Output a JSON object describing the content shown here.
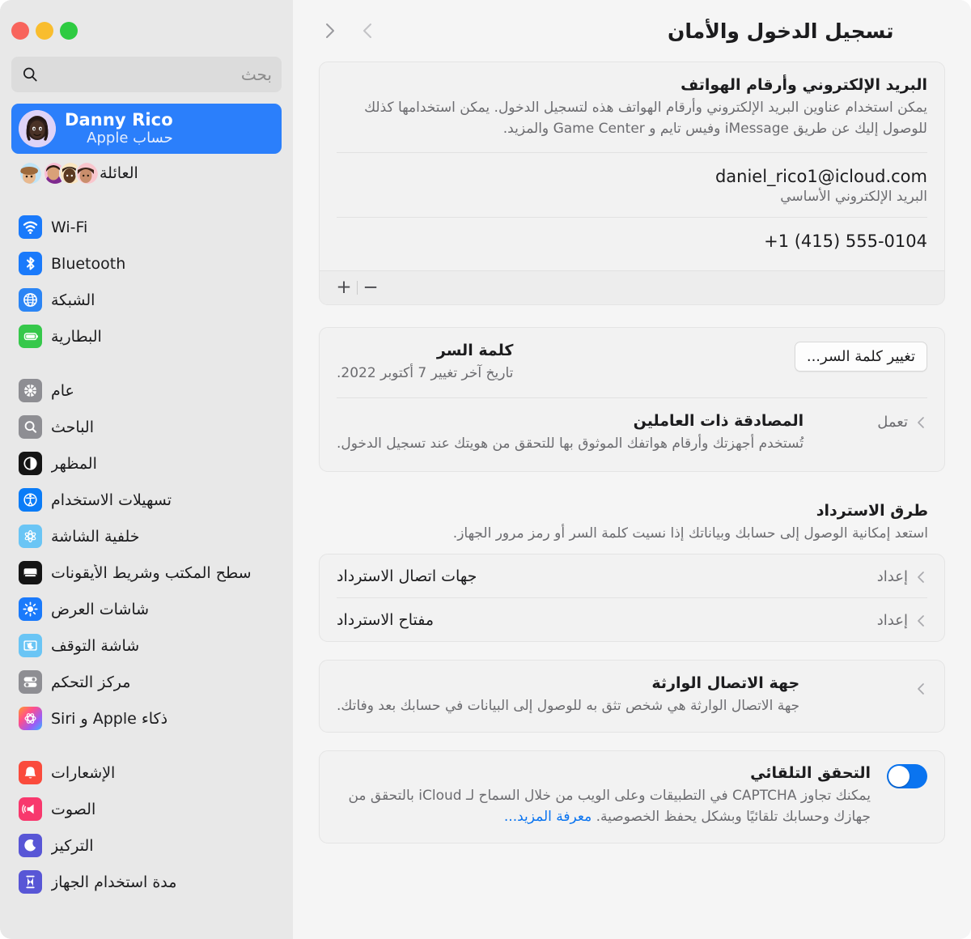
{
  "window": {
    "traffic_lights": [
      "close",
      "minimize",
      "zoom"
    ],
    "accent_blue": "#2b7ffb",
    "link_blue": "#0a74f0"
  },
  "sidebar": {
    "search": {
      "placeholder": "بحث",
      "value": "",
      "icon": "search-icon"
    },
    "account": {
      "name": "Danny Rico",
      "subtitle": "حساب Apple",
      "selected": true,
      "avatar": "memoji-avatar"
    },
    "family": {
      "label": "العائلة",
      "avatar_count": 4
    },
    "groups": [
      {
        "items": [
          {
            "label": "Wi-Fi",
            "icon": "wifi-icon",
            "color": "#1a7afb"
          },
          {
            "label": "Bluetooth",
            "icon": "bluetooth-icon",
            "color": "#1a7afb"
          },
          {
            "label": "الشبكة",
            "icon": "globe-icon",
            "color": "#2b85f5"
          },
          {
            "label": "البطارية",
            "icon": "battery-icon",
            "color": "#36c84b"
          }
        ]
      },
      {
        "items": [
          {
            "label": "عام",
            "icon": "gear-icon",
            "color": "#8e8e93"
          },
          {
            "label": "الباحث",
            "icon": "magnifier-icon",
            "color": "#8e8e93"
          },
          {
            "label": "المظهر",
            "icon": "appearance-icon",
            "color": "#1c1c1e"
          },
          {
            "label": "تسهيلات الاستخدام",
            "icon": "accessibility-icon",
            "color": "#0a7cf7"
          },
          {
            "label": "خلفية الشاشة",
            "icon": "wallpaper-icon",
            "color": "#6ac5f5"
          },
          {
            "label": "سطح المكتب وشريط الأيقونات",
            "icon": "desktop-dock-icon",
            "color": "#1c1c1e"
          },
          {
            "label": "شاشات العرض",
            "icon": "displays-icon",
            "color": "#1a7afb"
          },
          {
            "label": "شاشة التوقف",
            "icon": "screensaver-icon",
            "color": "#6ac5f5"
          },
          {
            "label": "مركز التحكم",
            "icon": "control-center-icon",
            "color": "#8e8e93"
          },
          {
            "label": "ذكاء Apple و Siri",
            "icon": "siri-icon",
            "color": "#ff4f8b"
          }
        ]
      },
      {
        "items": [
          {
            "label": "الإشعارات",
            "icon": "bell-icon",
            "color": "#fa4b3c"
          },
          {
            "label": "الصوت",
            "icon": "sound-icon",
            "color": "#f8386d"
          },
          {
            "label": "التركيز",
            "icon": "focus-moon-icon",
            "color": "#5856d6"
          },
          {
            "label": "مدة استخدام الجهاز",
            "icon": "screentime-icon",
            "color": "#5856d6"
          }
        ]
      }
    ]
  },
  "main": {
    "title": "تسجيل الدخول والأمان",
    "nav": {
      "back": "chevron-right-icon",
      "forward": "chevron-left-icon"
    },
    "email_card": {
      "title": "البريد الإلكتروني وأرقام الهواتف",
      "description": "يمكن استخدام عناوين البريد الإلكتروني وأرقام الهواتف هذه لتسجيل الدخول. يمكن استخدامها كذلك للوصول إليك عن طريق iMessage وفيس تايم و Game Center والمزيد.",
      "entries": [
        {
          "value": "daniel_rico1@icloud.com",
          "sub": "البريد الإلكتروني الأساسي"
        },
        {
          "value": "+1 (415) 555-0104",
          "sub": ""
        }
      ],
      "add_label": "+",
      "remove_label": "−"
    },
    "password_card": {
      "password": {
        "title": "كلمة السر",
        "subtitle": "تاريخ آخر تغيير 7 أكتوبر 2022.",
        "button": "تغيير كلمة السر..."
      },
      "two_factor": {
        "title": "المصادقة ذات العاملين",
        "subtitle": "تُستخدم أجهزتك وأرقام هواتفك الموثوق بها للتحقق من هويتك عند تسجيل الدخول.",
        "status": "تعمل"
      }
    },
    "recovery": {
      "title": "طرق الاسترداد",
      "description": "استعد إمكانية الوصول إلى حسابك وبياناتك إذا نسيت كلمة السر أو رمز مرور الجهاز.",
      "rows": [
        {
          "label": "جهات اتصال الاسترداد",
          "action": "إعداد"
        },
        {
          "label": "مفتاح الاسترداد",
          "action": "إعداد"
        }
      ]
    },
    "legacy_contact": {
      "title": "جهة الاتصال الوارثة",
      "description": "جهة الاتصال الوارثة هي شخص تثق به للوصول إلى البيانات في حسابك بعد وفاتك."
    },
    "auto_verification": {
      "title": "التحقق التلقائي",
      "description": "يمكنك تجاوز CAPTCHA في التطبيقات وعلى الويب من خلال السماح لـ iCloud بالتحقق من جهازك وحسابك تلقائيًا وبشكل يحفظ الخصوصية.",
      "link": "معرفة المزيد...",
      "enabled": true
    }
  }
}
